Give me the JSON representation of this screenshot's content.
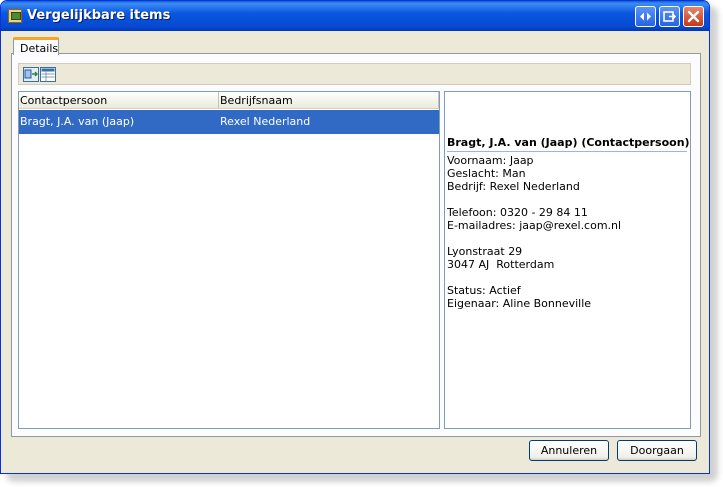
{
  "window": {
    "title": "Vergelijkbare items",
    "buttons": {
      "nav": "nav-icon",
      "maximize": "maximize-icon",
      "close": "close-icon"
    }
  },
  "tabs": [
    {
      "label": "Details",
      "selected": true
    }
  ],
  "toolbar": {
    "icons": [
      "compare-icon",
      "table-view-icon"
    ]
  },
  "list": {
    "columns": [
      "Contactpersoon",
      "Bedrijfsnaam"
    ],
    "rows": [
      {
        "contact": "Bragt, J.A. van (Jaap)",
        "company": "Rexel Nederland",
        "selected": true
      }
    ]
  },
  "details": {
    "heading": "Bragt, J.A. van (Jaap) (Contactpersoon)",
    "lines": [
      "Voornaam: Jaap",
      "Geslacht: Man",
      "Bedrijf: Rexel Nederland",
      "",
      "Telefoon: 0320 - 29 84 11",
      "E-mailadres: jaap@rexel.com.nl",
      "",
      "Lyonstraat 29",
      "3047 AJ  Rotterdam",
      "",
      "Status: Actief",
      "Eigenaar: Aline Bonneville"
    ]
  },
  "footer": {
    "cancel_label": "Annuleren",
    "continue_label": "Doorgaan"
  },
  "colors": {
    "title_bar": "#0548cf",
    "selection": "#316ac5",
    "tab_accent": "#f3a530"
  }
}
